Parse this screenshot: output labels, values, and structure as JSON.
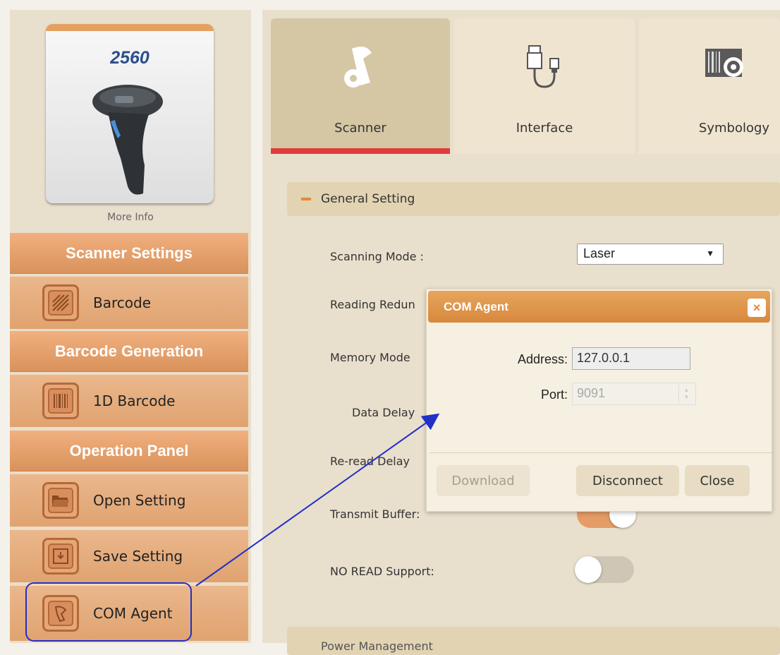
{
  "product": {
    "model": "2560",
    "more_info": "More Info"
  },
  "sidebar": {
    "sections": [
      {
        "title": "Scanner Settings",
        "items": [
          {
            "label": "Barcode",
            "icon": "barcode-pattern-icon"
          }
        ]
      },
      {
        "title": "Barcode Generation",
        "items": [
          {
            "label": "1D Barcode",
            "icon": "barcode-1d-icon"
          }
        ]
      },
      {
        "title": "Operation Panel",
        "items": [
          {
            "label": "Open Setting",
            "icon": "folder-icon"
          },
          {
            "label": "Save Setting",
            "icon": "save-icon"
          },
          {
            "label": "COM Agent",
            "icon": "scanner-icon"
          }
        ]
      }
    ]
  },
  "tabs": [
    {
      "label": "Scanner",
      "icon": "scanner-gear-icon",
      "active": true
    },
    {
      "label": "Interface",
      "icon": "usb-cable-icon",
      "active": false
    },
    {
      "label": "Symbology",
      "icon": "barcode-gear-icon",
      "active": false
    }
  ],
  "general": {
    "section_title": "General Setting",
    "scanning_mode_label": "Scanning Mode :",
    "scanning_mode_value": "Laser",
    "reading_redundancy_label": "Reading Redun",
    "memory_mode_label": "Memory Mode",
    "data_delay_label": "Data Delay",
    "reread_delay_label": "Re-read Delay",
    "transmit_buffer_label": "Transmit Buffer:",
    "transmit_buffer_on": true,
    "no_read_label": "NO READ Support:",
    "no_read_on": false
  },
  "bottom_section": {
    "title": "Power Management"
  },
  "dialog": {
    "title": "COM Agent",
    "address_label": "Address:",
    "address_value": "127.0.0.1",
    "port_label": "Port:",
    "port_value": "9091",
    "download_label": "Download",
    "disconnect_label": "Disconnect",
    "close_label": "Close"
  },
  "colors": {
    "accent": "#e8873a",
    "tab_indicator": "#e23b3b",
    "annotation": "#2030c8"
  }
}
